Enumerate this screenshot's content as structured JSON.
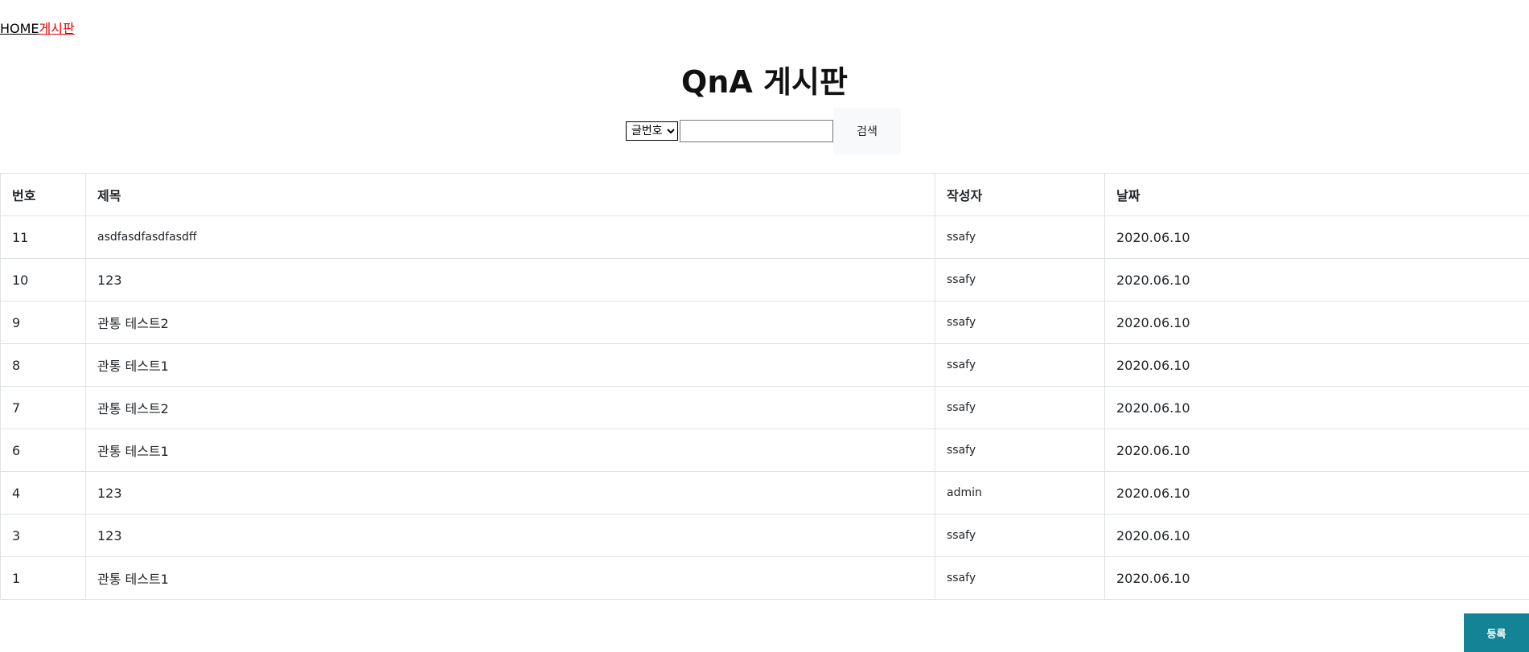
{
  "nav": {
    "home": "HOME",
    "board": "게시판"
  },
  "title": "QnA 게시판",
  "search": {
    "select_value": "글번호",
    "input_value": "",
    "button_label": "검색"
  },
  "table": {
    "headers": [
      "번호",
      "제목",
      "작성자",
      "날짜"
    ],
    "rows": [
      [
        "11",
        "asdfasdfasdfasdff",
        "ssafy",
        "2020.06.10"
      ],
      [
        "10",
        "123",
        "ssafy",
        "2020.06.10"
      ],
      [
        "9",
        "관통 테스트2",
        "ssafy",
        "2020.06.10"
      ],
      [
        "8",
        "관통 테스트1",
        "ssafy",
        "2020.06.10"
      ],
      [
        "7",
        "관통 테스트2",
        "ssafy",
        "2020.06.10"
      ],
      [
        "6",
        "관통 테스트1",
        "ssafy",
        "2020.06.10"
      ],
      [
        "4",
        "123",
        "admin",
        "2020.06.10"
      ],
      [
        "3",
        "123",
        "ssafy",
        "2020.06.10"
      ],
      [
        "1",
        "관통 테스트1",
        "ssafy",
        "2020.06.10"
      ]
    ]
  },
  "write_button": "등록",
  "colors": {
    "nav_active": "#e60000",
    "write_button_bg": "#138496",
    "search_button_bg": "#f8f9fa",
    "table_border": "#dee2e6"
  }
}
